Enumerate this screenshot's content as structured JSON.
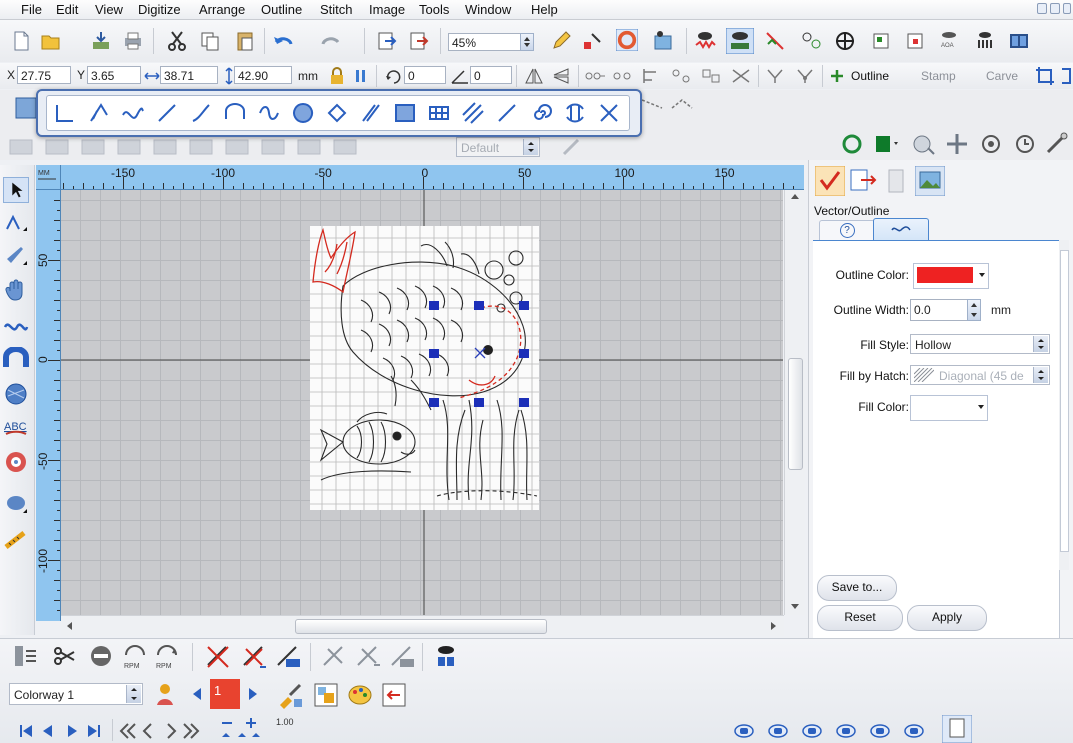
{
  "menu": [
    "File",
    "Edit",
    "View",
    "Digitize",
    "Arrange",
    "Outline",
    "Stitch",
    "Image",
    "Tools",
    "Window",
    "Help"
  ],
  "toolbar": {
    "zoom_value": "45%",
    "outline_label": "Outline",
    "stamp_label": "Stamp",
    "carve_label": "Carve"
  },
  "coords": {
    "x_label": "X",
    "x_value": "27.75",
    "y_label": "Y",
    "y_value": "3.65",
    "width_value": "38.71",
    "height_value": "42.90",
    "unit": "mm",
    "rotate_value": "0",
    "slant_value": "0"
  },
  "float_toolbar": {
    "icons": [
      "open-line-icon",
      "closed-line-icon",
      "curve-icon",
      "straight-line-icon",
      "running-line-icon",
      "column-icon",
      "satin-path-icon",
      "fill-area-icon",
      "corner-icon",
      "parallel-lines-icon",
      "complex-fill-icon",
      "net-fill-icon",
      "hatch-icon",
      "steps-icon",
      "spiral-icon",
      "motif-icon",
      "cross-icon"
    ]
  },
  "style_dropdown": "Default",
  "ruler": {
    "h_ticks": [
      "-150",
      "-100",
      "-50",
      "0",
      "50",
      "100",
      "150"
    ],
    "v_ticks": [
      "50",
      "0",
      "-50",
      "-100"
    ]
  },
  "panel": {
    "title": "Vector/Outline",
    "help_tab": "?",
    "outline_color_label": "Outline Color:",
    "outline_color": "#ee2222",
    "outline_width_label": "Outline Width:",
    "outline_width_value": "0.0",
    "outline_width_unit": "mm",
    "fill_style_label": "Fill Style:",
    "fill_style_value": "Hollow",
    "fill_hatch_label": "Fill by Hatch:",
    "fill_hatch_value": "Diagonal (45 de",
    "fill_color_label": "Fill Color:",
    "save_button": "Save to...",
    "reset_button": "Reset",
    "apply_button": "Apply"
  },
  "bottom": {
    "colorway": "Colorway 1",
    "color_index": "1",
    "scale_value": "1.00",
    "rpm_label_1": "RPM",
    "rpm_label_2": "RPM"
  },
  "colors": {
    "accent": "#3b79c9",
    "ruler": "#8fc5ef",
    "selection_handle": "#1c2fb8"
  }
}
